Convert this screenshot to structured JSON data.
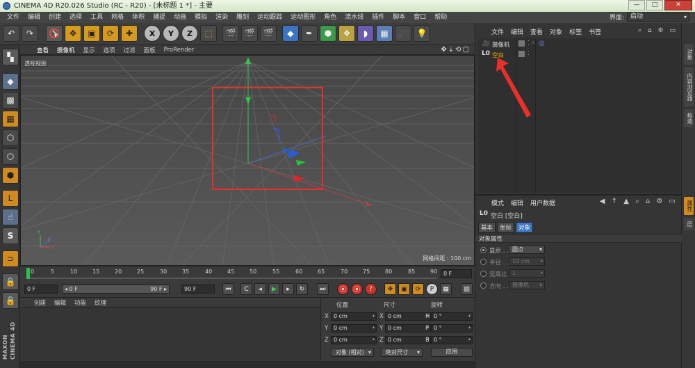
{
  "app": {
    "title": "CINEMA 4D R20.026 Studio (RC - R20) - [未标题 1 *] - 主要",
    "window_buttons": [
      "—",
      "□",
      "✕"
    ],
    "interface_label": "界面:",
    "interface_value": "启动"
  },
  "menu": [
    "文件",
    "编辑",
    "创建",
    "选择",
    "工具",
    "网格",
    "体积",
    "捕捉",
    "动画",
    "模拟",
    "渲染",
    "雕刻",
    "运动跟踪",
    "运动图形",
    "角色",
    "流水线",
    "插件",
    "脚本",
    "窗口",
    "帮助"
  ],
  "toolbar": {
    "undo": "↶",
    "redo": "↷",
    "x_axis": "X",
    "y_axis": "Y",
    "z_axis": "Z"
  },
  "viewport": {
    "menu": [
      "查看",
      "摄像机",
      "显示",
      "选项",
      "过滤",
      "面板",
      "ProRender"
    ],
    "nav_icons": "✥⇣⟲▢",
    "label": "透视视图",
    "grid_info": "网格间距 : 100 cm"
  },
  "timeline": {
    "ticks": [
      "0",
      "5",
      "10",
      "15",
      "20",
      "25",
      "30",
      "35",
      "40",
      "45",
      "50",
      "55",
      "60",
      "65",
      "70",
      "75",
      "80",
      "85",
      "90"
    ],
    "current_frame": "0 F"
  },
  "transport": {
    "start": "0 F",
    "range_left": "◂ 0 F",
    "range_right": "90 F ▸",
    "end": "90 F"
  },
  "materials": {
    "menu": [
      "创建",
      "编辑",
      "功能",
      "纹理"
    ]
  },
  "coords": {
    "headers": [
      "位置",
      "尺寸",
      "旋转"
    ],
    "rows": [
      {
        "a": "X",
        "pos": "0 cm",
        "b": "X",
        "size": "0 cm",
        "c": "H",
        "rot": "0 °"
      },
      {
        "a": "Y",
        "pos": "0 cm",
        "b": "Y",
        "size": "0 cm",
        "c": "P",
        "rot": "0 °"
      },
      {
        "a": "Z",
        "pos": "0 cm",
        "b": "Z",
        "size": "0 cm",
        "c": "B",
        "rot": "0 °"
      }
    ],
    "mode_object": "对象 (相对)",
    "mode_size": "绝对尺寸",
    "apply": "应用"
  },
  "objects": {
    "menu": [
      "文件",
      "编辑",
      "查看",
      "对象",
      "标签",
      "书签"
    ],
    "items": [
      {
        "name": "摄像机"
      },
      {
        "name": "空白"
      }
    ]
  },
  "side_tabs": [
    "对象",
    "内容浏览器",
    "构造"
  ],
  "side_tabs_lower": [
    "属性",
    "层"
  ],
  "attributes": {
    "menu": [
      "模式",
      "编辑",
      "用户数据"
    ],
    "title": "空白 [空白]",
    "tabs": [
      "基本",
      "坐标",
      "对象"
    ],
    "section": "对象属性",
    "rows": [
      {
        "label": "显示 . .",
        "value": "圆点"
      },
      {
        "label": "半径 . .",
        "value": "10 cm"
      },
      {
        "label": "宽高比",
        "value": "1"
      },
      {
        "label": "方向 . .",
        "value": "摄像机"
      }
    ]
  },
  "colors": {
    "accent_orange": "#d08a22",
    "selection_yellow": "#f1b100",
    "annotation_red": "#e8302a",
    "axis_green": "#28c43a",
    "axis_blue": "#2a5cd8",
    "axis_red": "#d82a2a"
  }
}
